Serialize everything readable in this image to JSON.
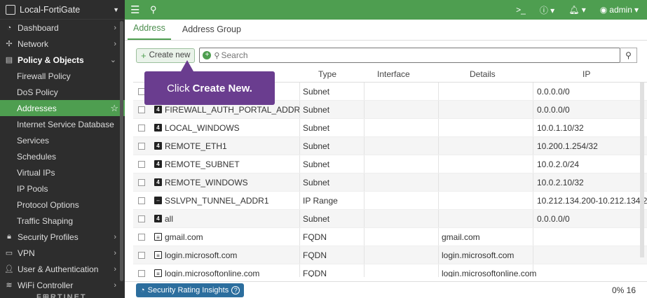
{
  "sidebar": {
    "device": "Local-FortiGate",
    "items": [
      {
        "label": "Dashboard",
        "icon": "dashboard-icon"
      },
      {
        "label": "Network",
        "icon": "network-icon"
      },
      {
        "label": "Policy & Objects",
        "icon": "policy-icon"
      }
    ],
    "sub_items": [
      {
        "label": "Firewall Policy"
      },
      {
        "label": "DoS Policy"
      },
      {
        "label": "Addresses"
      },
      {
        "label": "Internet Service Database"
      },
      {
        "label": "Services"
      },
      {
        "label": "Schedules"
      },
      {
        "label": "Virtual IPs"
      },
      {
        "label": "IP Pools"
      },
      {
        "label": "Protocol Options"
      },
      {
        "label": "Traffic Shaping"
      }
    ],
    "bottom_items": [
      {
        "label": "Security Profiles",
        "icon": "lock-icon"
      },
      {
        "label": "VPN",
        "icon": "vpn-icon"
      },
      {
        "label": "User & Authentication",
        "icon": "user-icon"
      },
      {
        "label": "WiFi Controller",
        "icon": "wifi-icon"
      }
    ],
    "brand": "F⊞RTINET"
  },
  "topbar": {
    "user": "admin"
  },
  "tabs": [
    {
      "label": "Address"
    },
    {
      "label": "Address Group"
    }
  ],
  "toolbar": {
    "create_label": "Create new",
    "search_placeholder": "Search"
  },
  "callout": {
    "prefix": "Click",
    "bold": "Create New."
  },
  "table": {
    "headers": {
      "type": "Type",
      "interface": "Interface",
      "details": "Details",
      "ip": "IP"
    },
    "rows": [
      {
        "name": "",
        "type": "Subnet",
        "details": "",
        "ip": "0.0.0.0/0"
      },
      {
        "name": "FIREWALL_AUTH_PORTAL_ADDRESS",
        "type": "Subnet",
        "details": "",
        "ip": "0.0.0.0/0"
      },
      {
        "name": "LOCAL_WINDOWS",
        "type": "Subnet",
        "details": "",
        "ip": "10.0.1.10/32"
      },
      {
        "name": "REMOTE_ETH1",
        "type": "Subnet",
        "details": "",
        "ip": "10.200.1.254/32"
      },
      {
        "name": "REMOTE_SUBNET",
        "type": "Subnet",
        "details": "",
        "ip": "10.0.2.0/24"
      },
      {
        "name": "REMOTE_WINDOWS",
        "type": "Subnet",
        "details": "",
        "ip": "10.0.2.10/32"
      },
      {
        "name": "SSLVPN_TUNNEL_ADDR1",
        "type": "IP Range",
        "details": "",
        "ip": "10.212.134.200-10.212.134.2"
      },
      {
        "name": "all",
        "type": "Subnet",
        "details": "",
        "ip": "0.0.0.0/0"
      },
      {
        "name": "gmail.com",
        "type": "FQDN",
        "details": "gmail.com",
        "ip": ""
      },
      {
        "name": "login.microsoft.com",
        "type": "FQDN",
        "details": "login.microsoft.com",
        "ip": ""
      },
      {
        "name": "login.microsoftonline.com",
        "type": "FQDN",
        "details": "login.microsoftonline.com",
        "ip": ""
      }
    ]
  },
  "footer": {
    "sri_label": "Security Rating Insights",
    "count": "0% 16"
  }
}
